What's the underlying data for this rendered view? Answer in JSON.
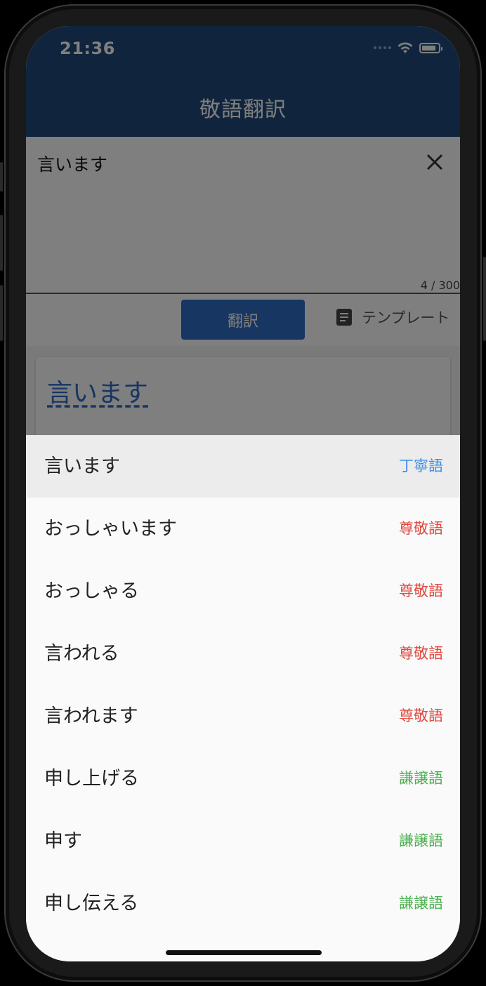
{
  "status_bar": {
    "time": "21:36"
  },
  "app_bar": {
    "title": "敬語翻訳"
  },
  "input": {
    "value": "言います",
    "counter": "4 / 300"
  },
  "actions": {
    "translate_label": "翻訳",
    "template_label": "テンプレート"
  },
  "result": {
    "text": "言います"
  },
  "colors": {
    "appbar": "#204a7a",
    "teineigo": "#3d8ee6",
    "sonkeigo": "#e0483f",
    "kenjougo": "#4caf50"
  },
  "icons": [
    "wifi-icon",
    "battery-icon",
    "close-icon",
    "document-icon"
  ],
  "options": [
    {
      "label": "言います",
      "tag": "丁寧語",
      "color": "#3d8ee6",
      "selected": true
    },
    {
      "label": "おっしゃいます",
      "tag": "尊敬語",
      "color": "#e0483f",
      "selected": false
    },
    {
      "label": "おっしゃる",
      "tag": "尊敬語",
      "color": "#e0483f",
      "selected": false
    },
    {
      "label": "言われる",
      "tag": "尊敬語",
      "color": "#e0483f",
      "selected": false
    },
    {
      "label": "言われます",
      "tag": "尊敬語",
      "color": "#e0483f",
      "selected": false
    },
    {
      "label": "申し上げる",
      "tag": "謙譲語",
      "color": "#4caf50",
      "selected": false
    },
    {
      "label": "申す",
      "tag": "謙譲語",
      "color": "#4caf50",
      "selected": false
    },
    {
      "label": "申し伝える",
      "tag": "謙譲語",
      "color": "#4caf50",
      "selected": false
    }
  ]
}
